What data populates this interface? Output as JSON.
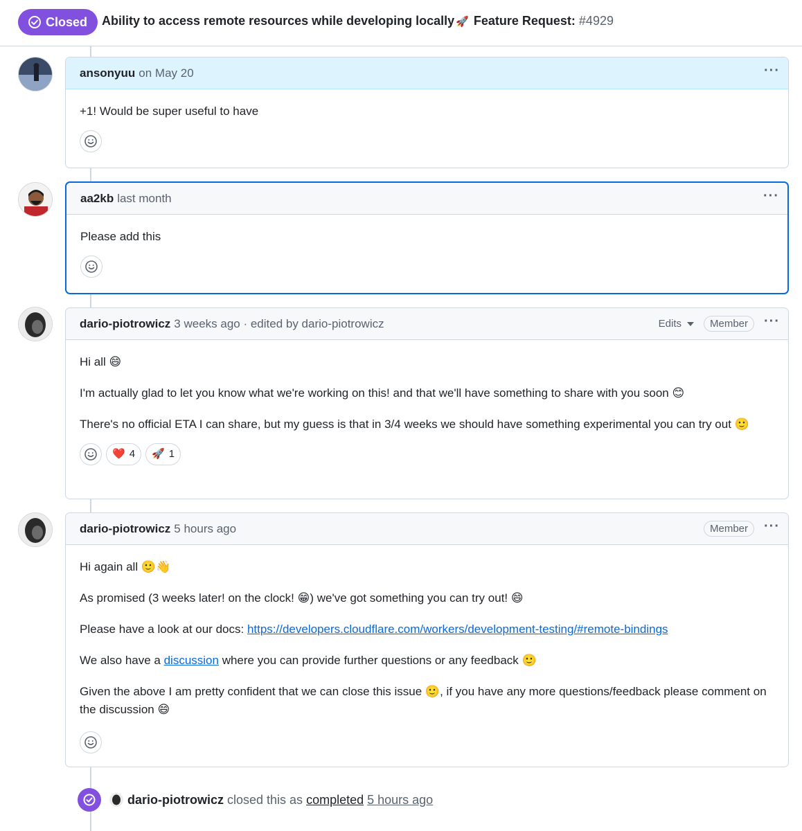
{
  "issue": {
    "state": "Closed",
    "title_text": "Ability to access remote resources while developing locally",
    "title_rocket": "🚀",
    "title_suffix": " Feature Request: ",
    "number": "#4929"
  },
  "comments": [
    {
      "author": "ansonyuu",
      "meta": "on May 20",
      "body": [
        "+1! Would be super useful to have"
      ]
    },
    {
      "author": "aa2kb",
      "meta": "last month",
      "body": [
        "Please add this"
      ]
    },
    {
      "author": "dario-piotrowicz",
      "meta": "3 weeks ago · edited by dario-piotrowicz",
      "edits_label": "Edits",
      "role": "Member",
      "body": [
        "Hi all 😄",
        "I'm actually glad to let you know what we're working on this! and that we'll have something to share with you soon 😊",
        "There's no official ETA I can share, but my guess is that in 3/4 weeks we should have something experimental you can try out 🙂"
      ],
      "reactions": [
        {
          "emoji": "❤️",
          "count": "4"
        },
        {
          "emoji": "🚀",
          "count": "1"
        }
      ]
    },
    {
      "author": "dario-piotrowicz",
      "meta": "5 hours ago",
      "role": "Member",
      "body": [
        "Hi again all 🙂👋",
        "As promised (3 weeks later! on the clock! 😁) we've got something you can try out! 😄",
        "Please have a look at our docs: ",
        "We also have a ",
        "Given the above I am pretty confident that we can close this issue 🙂, if you have any more questions/feedback please comment on the discussion 😄"
      ],
      "docs_link": "https://developers.cloudflare.com/workers/development-testing/#remote-bindings",
      "discussion_link": "discussion",
      "discussion_after": " where you can provide further questions or any feedback 🙂"
    }
  ],
  "event": {
    "actor": "dario-piotrowicz",
    "text": "closed this as",
    "reason": "completed",
    "time": "5 hours ago"
  }
}
